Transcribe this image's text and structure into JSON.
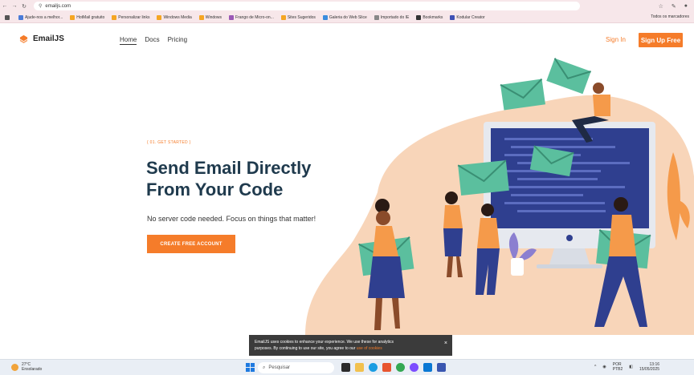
{
  "browser": {
    "url": "emailjs.com",
    "bookmarks": [
      {
        "label": "Ajude-nos a melhor...",
        "color": "#4a7bd8"
      },
      {
        "label": "HotMail gratuito",
        "color": "#f5a623"
      },
      {
        "label": "Personalizar links",
        "color": "#f5a623"
      },
      {
        "label": "Windows Media",
        "color": "#f5a623"
      },
      {
        "label": "Windows",
        "color": "#f5a623"
      },
      {
        "label": "Frango de Micro-on...",
        "color": "#9b59b6"
      },
      {
        "label": "Sites Sugeridos",
        "color": "#f5a623"
      },
      {
        "label": "Galeria do Web Slice",
        "color": "#3a8dde"
      },
      {
        "label": "Importado do IE",
        "color": "#888888"
      },
      {
        "label": "Bookmarks",
        "color": "#333333"
      },
      {
        "label": "Kodular Creator",
        "color": "#3f51b5"
      }
    ],
    "all_bookmarks": "Todos os marcadores"
  },
  "site": {
    "logo": "EmailJS",
    "nav": [
      "Home",
      "Docs",
      "Pricing"
    ],
    "sign_in": "Sign In",
    "sign_up": "Sign Up Free",
    "accent": "#f57c2a"
  },
  "hero": {
    "eyebrow": "{ 01. GET STARTED }",
    "title_line1": "Send Email Directly",
    "title_line2": "From Your Code",
    "subtitle": "No server code needed. Focus on things that matter!",
    "cta": "CREATE FREE ACCOUNT"
  },
  "cookie": {
    "text_line1": "EmailJS uses cookies to enhance your experience. We use these for analytics",
    "text_line2": "purposes. By continuing to use our site, you agree to our",
    "link": "use of cookies",
    "close": "×"
  },
  "taskbar": {
    "temp": "27°C",
    "weather": "Ensolarado",
    "search": "Pesquisar",
    "lang1": "POR",
    "lang2": "PTB2",
    "time": "13:16",
    "date": "15/05/2025"
  }
}
